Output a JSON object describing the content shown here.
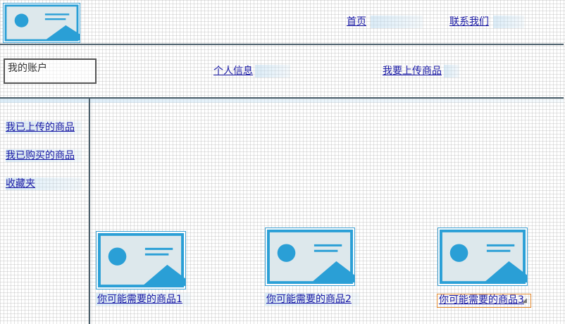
{
  "header": {
    "logo_icon": "image-placeholder-icon",
    "nav": [
      {
        "label": "首页"
      },
      {
        "label": "联系我们"
      }
    ]
  },
  "account_bar": {
    "account_label": "我的账户",
    "links": [
      {
        "label": "个人信息"
      },
      {
        "label": "我要上传商品"
      }
    ]
  },
  "sidebar": {
    "items": [
      {
        "label": "我已上传的商品"
      },
      {
        "label": "我已购买的商品"
      },
      {
        "label": "收藏夹"
      }
    ]
  },
  "recommendations": [
    {
      "label": "你可能需要的商品1",
      "icon": "image-placeholder-icon"
    },
    {
      "label": "你可能需要的商品2",
      "icon": "image-placeholder-icon"
    },
    {
      "label": "你可能需要的商品3",
      "icon": "image-placeholder-icon",
      "selected": true
    }
  ],
  "colors": {
    "placeholder_blue": "#2a9fd6",
    "placeholder_bg": "#dde8ec",
    "divider": "#4b5f6b",
    "link": "#1a1aa6",
    "selection": "#e58a2e"
  }
}
